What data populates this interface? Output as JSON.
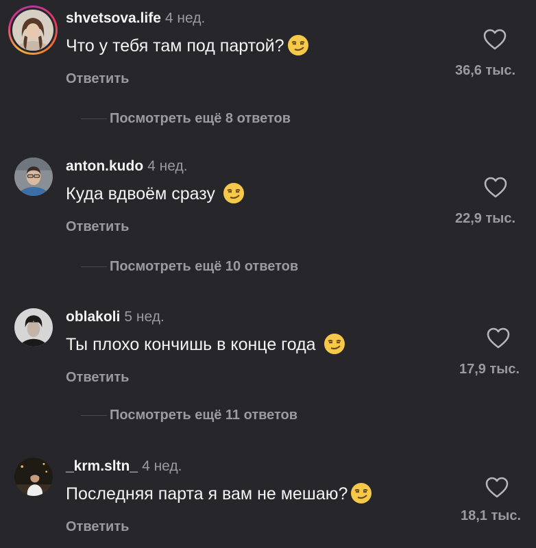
{
  "comments": [
    {
      "username": "shvetsova.life",
      "time": "4 нед.",
      "text": "Что у тебя там под партой?",
      "emoji": "smirking-face",
      "reply_label": "Ответить",
      "likes": "36,6 тыс.",
      "view_more": "Посмотреть ещё 8 ответов"
    },
    {
      "username": "anton.kudo",
      "time": "4 нед.",
      "text": "Куда вдвоём сразу",
      "emoji": "smirking-face",
      "reply_label": "Ответить",
      "likes": "22,9 тыс.",
      "view_more": "Посмотреть ещё 10 ответов"
    },
    {
      "username": "oblakoli",
      "time": "5 нед.",
      "text": "Ты плохо кончишь в конце года",
      "emoji": "smirking-face",
      "reply_label": "Ответить",
      "likes": "17,9 тыс.",
      "view_more": "Посмотреть ещё 11 ответов"
    },
    {
      "username": "_krm.sltn_",
      "time": "4 нед.",
      "text": "Последняя парта я вам не мешаю?",
      "emoji": "smirking-face",
      "reply_label": "Ответить",
      "likes": "18,1 тыс."
    }
  ],
  "colors": {
    "background": "#27272b",
    "primary_text": "#f3f3f3",
    "secondary_text": "#9a9aa0"
  }
}
